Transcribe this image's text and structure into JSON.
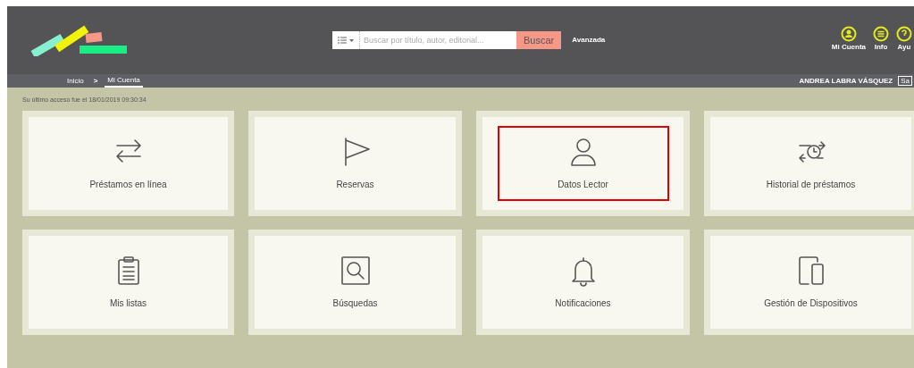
{
  "search": {
    "placeholder": "Buscar por título, autor, editorial...",
    "button": "Buscar",
    "advanced": "Avanzada"
  },
  "header_links": [
    {
      "label": "Mi Cuenta"
    },
    {
      "label": "Info"
    },
    {
      "label": "Ayu"
    }
  ],
  "breadcrumb": [
    {
      "label": "Inicio",
      "selected": false
    },
    {
      "label": "Mi Cuenta",
      "selected": true
    }
  ],
  "breadcrumb_separator": ">",
  "user_name": "ANDREA LABRA VÁSQUEZ",
  "user_button": "Sa",
  "last_access": "Su último acceso fue el 18/01/2019 09:30:34",
  "tiles": [
    {
      "label": "Préstamos en línea",
      "highlighted": false
    },
    {
      "label": "Reservas",
      "highlighted": false
    },
    {
      "label": "Datos Lector",
      "highlighted": true
    },
    {
      "label": "Historial de préstamos",
      "highlighted": false
    },
    {
      "label": "Mis listas",
      "highlighted": false
    },
    {
      "label": "Búsquedas",
      "highlighted": false
    },
    {
      "label": "Notificaciones",
      "highlighted": false
    },
    {
      "label": "Gestión de Dispositivos",
      "highlighted": false
    }
  ]
}
